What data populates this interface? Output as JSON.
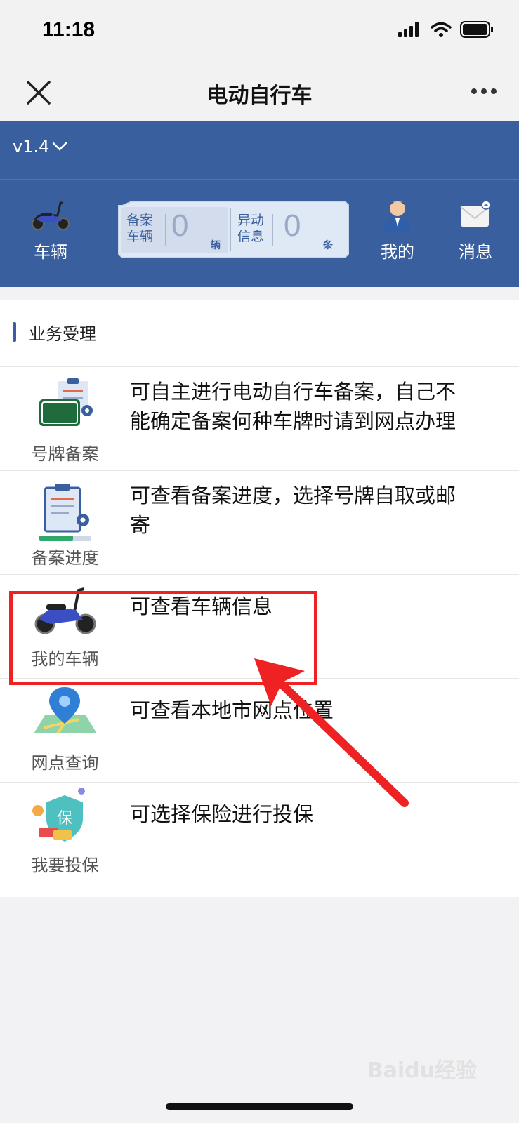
{
  "status": {
    "time": "11:18"
  },
  "nav": {
    "title": "电动自行车"
  },
  "banner": {
    "version": "v1.4",
    "tools": {
      "vehicle": "车辆",
      "mine": "我的",
      "messages": "消息"
    },
    "stats": {
      "registered_label": "备案车辆",
      "registered_value": "0",
      "registered_unit": "辆",
      "anomaly_label": "异动信息",
      "anomaly_value": "0",
      "anomaly_unit": "条"
    }
  },
  "section": {
    "title": "业务受理"
  },
  "services": [
    {
      "label": "号牌备案",
      "desc": "可自主进行电动自行车备案，自己不能确定备案何种车牌时请到网点办理",
      "icon": "license-plate-icon"
    },
    {
      "label": "备案进度",
      "desc": "可查看备案进度，选择号牌自取或邮寄",
      "icon": "clipboard-progress-icon"
    },
    {
      "label": "我的车辆",
      "desc": "可查看车辆信息",
      "icon": "scooter-icon"
    },
    {
      "label": "网点查询",
      "desc": "可查看本地市网点位置",
      "icon": "map-pin-icon"
    },
    {
      "label": "我要投保",
      "desc": "可选择保险进行投保",
      "icon": "insurance-shield-icon"
    }
  ],
  "watermark": "Baidu经验",
  "colors": {
    "brand": "#3a5f9e",
    "highlight": "#ee2222"
  }
}
